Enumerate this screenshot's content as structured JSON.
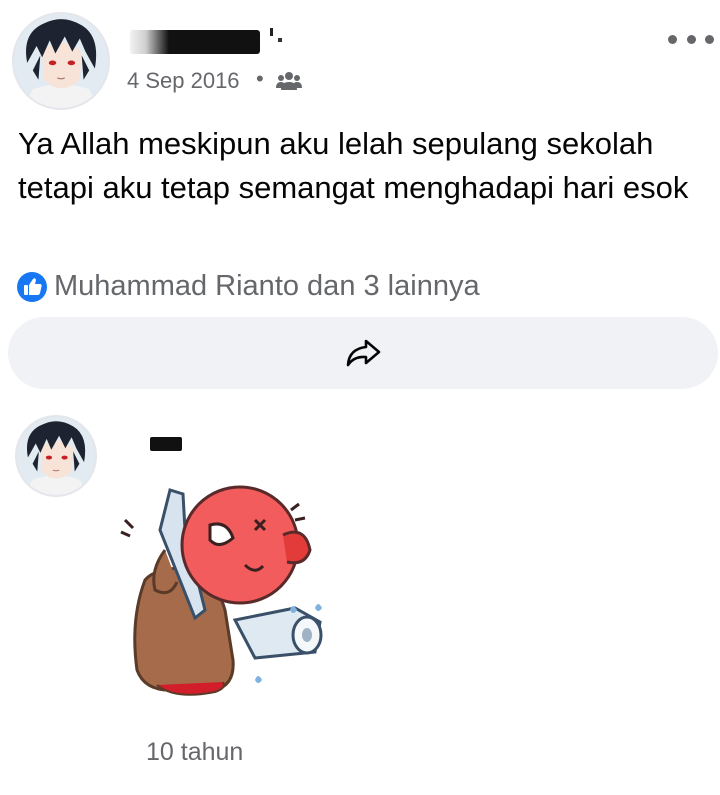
{
  "post": {
    "date": "4 Sep 2016",
    "separator": "•",
    "text": "Ya Allah meskipun aku lelah sepulang sekolah tetapi aku tetap semangat menghadapi hari esok",
    "reactions_label": "Muhammad Rianto dan 3 lainnya",
    "icons": {
      "audience": "friends-icon",
      "more": "more-options-icon",
      "reaction": "like-icon",
      "share": "share-icon"
    }
  },
  "comment": {
    "time": "10 tahun",
    "icons": {
      "sticker": "crying-sticker"
    }
  },
  "colors": {
    "like_blue": "#1877f2",
    "meta_gray": "#65676b",
    "bar_bg": "#f0f2f5"
  }
}
